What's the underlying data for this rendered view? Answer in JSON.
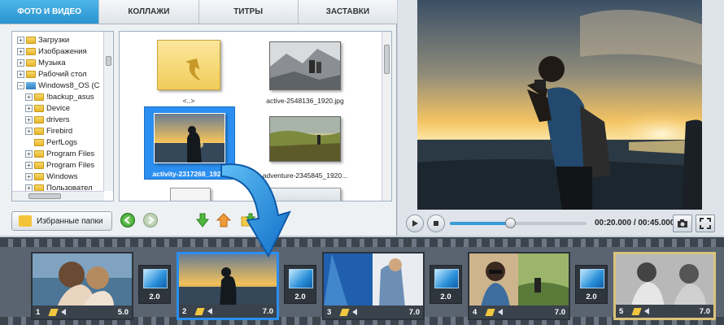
{
  "tabs": [
    {
      "label": "ФОТО И ВИДЕО",
      "active": true
    },
    {
      "label": "КОЛЛАЖИ",
      "active": false
    },
    {
      "label": "ТИТРЫ",
      "active": false
    },
    {
      "label": "ЗАСТАВКИ",
      "active": false
    }
  ],
  "tree": {
    "items": [
      {
        "label": "Загрузки",
        "expander": "+",
        "icon": "folder-icon"
      },
      {
        "label": "Изображения",
        "expander": "+",
        "icon": "folder-icon"
      },
      {
        "label": "Музыка",
        "expander": "+",
        "icon": "folder-icon"
      },
      {
        "label": "Рабочий стол",
        "expander": "+",
        "icon": "folder-icon"
      },
      {
        "label": "Windows8_OS (C",
        "expander": "−",
        "icon": "drive-icon"
      },
      {
        "label": "!backup_asus",
        "expander": "+",
        "icon": "folder-icon"
      },
      {
        "label": "Device",
        "expander": "+",
        "icon": "folder-icon"
      },
      {
        "label": "drivers",
        "expander": "+",
        "icon": "folder-icon"
      },
      {
        "label": "Firebird",
        "expander": "+",
        "icon": "folder-icon"
      },
      {
        "label": "PerfLogs",
        "expander": "",
        "icon": "folder-icon"
      },
      {
        "label": "Program Files",
        "expander": "+",
        "icon": "folder-icon"
      },
      {
        "label": "Program Files",
        "expander": "+",
        "icon": "folder-icon"
      },
      {
        "label": "Windows",
        "expander": "+",
        "icon": "folder-icon"
      },
      {
        "label": "Пользовател",
        "expander": "+",
        "icon": "folder-icon"
      }
    ]
  },
  "files": [
    {
      "label": "<..>",
      "kind": "up-folder"
    },
    {
      "label": "active-2548136_1920.jpg",
      "kind": "photo"
    },
    {
      "label": "activity-2317268_192...",
      "kind": "photo",
      "selected": true
    },
    {
      "label": "adventure-2345845_1920...",
      "kind": "photo"
    }
  ],
  "bottombar": {
    "favorites_label": "Избранные папки"
  },
  "player": {
    "time": "00:20.000 / 00:45.000",
    "progress": 0.44
  },
  "timeline": {
    "slides": [
      {
        "num": "1",
        "duration": "5.0"
      },
      {
        "num": "2",
        "duration": "7.0",
        "selected": true
      },
      {
        "num": "3",
        "duration": "7.0"
      },
      {
        "num": "4",
        "duration": "7.0"
      },
      {
        "num": "5",
        "duration": "7.0"
      }
    ],
    "transitions": [
      "2.0",
      "2.0",
      "2.0",
      "2.0"
    ]
  },
  "colors": {
    "accent": "#2a93cf",
    "selection": "#2a8ff0"
  }
}
